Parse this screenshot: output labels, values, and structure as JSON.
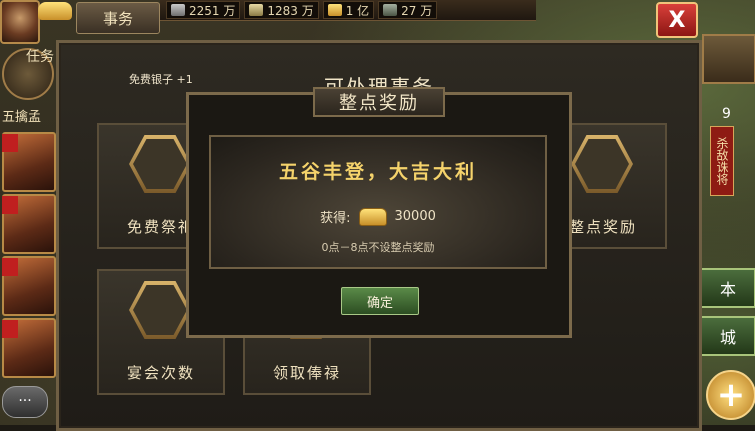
{
  "top_bar": {
    "affairs_tab": "事务",
    "resources": [
      {
        "icon": "copper-coin-icon",
        "value": "2251 万"
      },
      {
        "icon": "grain-icon",
        "value": "1283 万"
      },
      {
        "icon": "gold-ingot-icon",
        "value": "1 亿"
      },
      {
        "icon": "soldiers-icon",
        "value": "27 万"
      }
    ],
    "close_label": "X"
  },
  "left": {
    "task_label": "任务",
    "hero_name": "五擒孟",
    "chat_label": "···"
  },
  "right": {
    "kill_count": "9",
    "kill_tag": "杀敌诛将",
    "btn_1": "本",
    "btn_2": "城",
    "plus": "+"
  },
  "panel": {
    "free_silver": "免费银子 +1",
    "title": "可处理事务",
    "tiles": [
      {
        "caption": "免费祭祀"
      },
      {
        "caption": "整点奖励"
      },
      {
        "caption": "宴会次数"
      },
      {
        "caption": "领取俸禄"
      }
    ]
  },
  "dialog": {
    "title": "整点奖励",
    "headline": "五谷丰登，大吉大利",
    "reward_label": "获得:",
    "reward_icon": "gold-ingot-icon",
    "reward_value": "30000",
    "note": "0点－8点不设整点奖励",
    "confirm": "确定"
  }
}
